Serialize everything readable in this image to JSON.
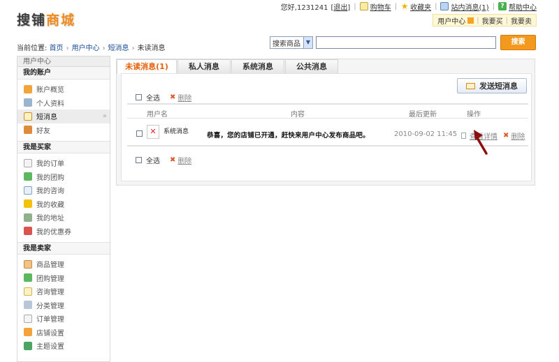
{
  "logo": {
    "part1": "搜铺",
    "part2": "商城"
  },
  "toplinks": {
    "greeting": "您好,1231241",
    "logout": "[退出]",
    "cart": "购物车",
    "favorites": "收藏夹",
    "site_messages": "站内消息(1)",
    "help": "帮助中心"
  },
  "ucbar": {
    "user_center": "用户中心",
    "buy": "我要买",
    "sell": "我要卖"
  },
  "breadcrumb": {
    "prefix": "当前位置:",
    "home": "首页",
    "user_center": "用户中心",
    "messages": "短消息",
    "current": "未读消息"
  },
  "search": {
    "select_value": "搜索商品",
    "input_value": "",
    "button": "搜索"
  },
  "sidebar": {
    "header": "用户中心",
    "sections": [
      {
        "title": "我的账户",
        "items": [
          "账户概览",
          "个人资料",
          "短消息",
          "好友"
        ]
      },
      {
        "title": "我是买家",
        "items": [
          "我的订单",
          "我的团购",
          "我的咨询",
          "我的收藏",
          "我的地址",
          "我的优惠券"
        ]
      },
      {
        "title": "我是卖家",
        "items": [
          "商品管理",
          "团购管理",
          "咨询管理",
          "分类管理",
          "订单管理",
          "店铺设置",
          "主题设置"
        ]
      }
    ],
    "active_item": "短消息",
    "active_arrow": "»"
  },
  "tabs": [
    "未读消息(1)",
    "私人消息",
    "系统消息",
    "公共消息"
  ],
  "panel": {
    "send_button": "发送短消息",
    "select_all": "全选",
    "delete": "删除",
    "columns": [
      "用户名",
      "内容",
      "最后更新",
      "操作"
    ],
    "rows": [
      {
        "sender": "系统消息",
        "content": "恭喜，您的店铺已开通，赶快来用户中心发布商品吧。",
        "date": "2010-09-02 11:45",
        "view": "查看详情",
        "delete": "删除"
      }
    ]
  },
  "colors": {
    "accent": "#e8600b",
    "search_button": "#f39a1e",
    "pointer": "#8b0f0f"
  }
}
